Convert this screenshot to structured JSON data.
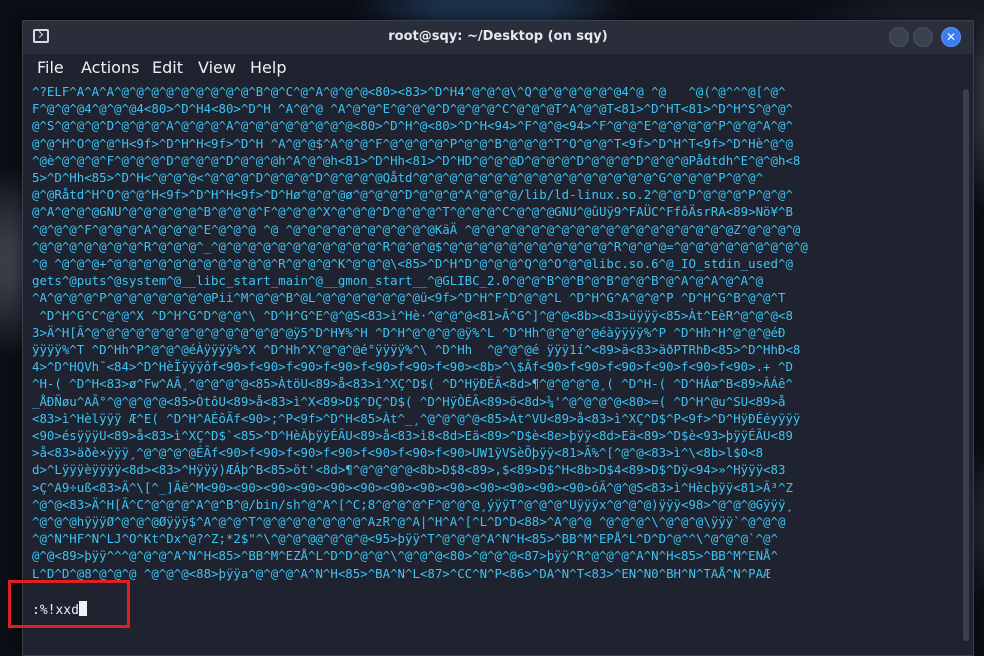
{
  "window": {
    "title": "root@sqy: ~/Desktop (on sqy)",
    "close_glyph": "✕"
  },
  "menu": [
    "File",
    "Actions",
    "Edit",
    "View",
    "Help"
  ],
  "terminal": {
    "lines": [
      "^?ELF^A^A^A^@^@^@^@^@^@^@^@^@^B^@^C^@^A^@^@^@<80><83>^D^H4^@^@^@\\^Q^@^@^@^@^@^@4^@ ^@   ^@(^@^^^@[^@^",
      "F^@^@^@4^@^@^@4<80>^D^H4<80>^D^H ^A^@^@ ^A^@^@^E^@^@^@^D^@^@^@^C^@^@^@T^A^@^@T<81>^D^HT<81>^D^H^S^@^@^",
      "@^S^@^@^@^D^@^@^@^A^@^@^@^A^@^@^@^@^@^@^@^@<80>^D^H^@<80>^D^H<94>^F^@^@<94>^F^@^@^E^@^@^@^@^P^@^@^A^@^",
      "@^@^H^O^@^@^H<9f>^D^H^H<9f>^D^H ^A^@^@$^A^@^@^F^@^@^@^@^P^@^@^B^@^@^@^T^O^@^@^T<9f>^D^H^T<9f>^D^Hè^@^@",
      "^@è^@^@^@^F^@^@^@^D^@^@^@^D^@^@^@h^A^@^@h<81>^D^Hh<81>^D^HD^@^@^@D^@^@^@^D^@^@^@^D^@^@^@Pådtdh^E^@^@h<8",
      "5>^D^Hh<85>^D^H<^@^@^@<^@^@^@^D^@^@^@^D^@^@^@^@Qåtd^@^@^@^@^@^@^@^@^@^@^@^@^@^@^@^@^G^@^@^@^P^@^@^",
      "@^@Råtd^H^O^@^@^H<9f>^D^H^H<9f>^D^Hø^@^@^@ø^@^@^@^D^@^@^@^A^@^@^@/lib/ld-linux.so.2^@^@^D^@^@^@^P^@^@^",
      "@^A^@^@^@GNU^@^@^@^@^@^B^@^@^@^F^@^@^@^X^@^@^@^D^@^@^@^T^@^@^@^C^@^@^@GNU^@ûUÿ9^FAÜC^FfôÄsrRA<89>Nö¥^B",
      "^@^@^@^F^@^@^@^A^@^@^@^E^@^@^@ ^@ ^@^@^@^@^@^@^@^@^@^@KäÄ ^@^@^@^@^@^@^@^@^@^@^@^@^@^@^@^@^@^@Z^@^@^@^@",
      "^@^@^@^@^@^@^@^R^@^@^@^_^@^@^@^@^@^@^@^@^@^@^@^R^@^@^@$^@^@^@^@^@^@^@^@^@^@^@^R^@^@^@=^@^@^@^@^@^@^@^@^@",
      "^@ ^@^@^@+^@^@^@^@^@^@^@^@^@^@^@^R^@^@^@^K^@^@^@\\<85>^D^H^D^@^@^@^Q^@^O^@^@libc.so.6^@_IO_stdin_used^@",
      "gets^@puts^@system^@__libc_start_main^@__gmon_start__^@GLIBC_2.0^@^@^B^@^B^@^B^@^@^B^@^A^@^A^@^A^@",
      "^A^@^@^@^P^@^@^@^@^@^@^@Pii^M^@^@^B^@L^@^@^@^@^@^@^@ü<9f>^D^H^F^D^@^@^L ^D^H^G^A^@^@^P ^D^H^G^B^@^@^T",
      " ^D^H^G^C^@^@^X ^D^H^G^D^@^@^\\ ^D^H^G^E^@^@S<83>ì^Hè·^@^@^@<81>Ã^G^]^@^@<8b><83>üÿÿÿ<85>Àt^EèR^@^@^@<8",
      "3>Ä^H[Ã^@^@^@^@^@^@^@^@^@^@^@^@^@^@ÿ5^D^H¥%^H ^D^H^@^@^@^@ÿ%^L ^D^Hh^@^@^@^@éàÿÿÿÿ%^P ^D^Hh^H^@^@^@éÐ",
      "ÿÿÿÿ%^T ^D^Hh^P^@^@^@éÀÿÿÿÿ%^X ^D^Hh^X^@^@^@é°ÿÿÿÿ%^\\ ^D^Hh  ^@^@^@é ÿÿÿ1í^<89>ä<83>äðPTRhÐ<85>^D^HhÐ<8",
      "4>^D^HQVh¯<84>^D^HèÏÿÿÿôf<90>f<90>f<90>f<90>f<90>f<90>f<90><8b>^\\$Ãf<90>f<90>f<90>f<90>f<90>f<90>.+ ^D",
      "^H-( ^D^H<83>ø^Fw^AÃ¸^@^@^@^@<85>ÀtöU<89>å<83>ì^XÇ^D$( ^D^HÿÐÉÃ<8d>¶^@^@^@^@¸( ^D^H-( ^D^HÁø^B<89>ÂÁê^",
      "_ÅÐÑøu^AÃ°^@^@^@^@<85>ÒtôU<89>å<83>ì^X<89>D$^DÇ^D$( ^D^HÿÒÉÃ<89>ö<8d>¼'^@^@^@^@<80>=( ^D^H^@u^SU<89>å",
      "<83>ì^Hèlÿÿÿ Æ^E( ^D^H^AÉôÃf<90>;^P<9f>^D^H<85>Àt^_¸^@^@^@^@<85>Àt^VU<89>å<83>ì^XÇ^D$^P<9f>^D^HÿÐÉéyÿÿÿ",
      "<90>ésÿÿÿU<89>å<83>ì^XÇ^D$`<85>^D^HèÀþÿÿÉÃU<89>å<83>ì8<8d>Eä<89>^D$è<8e>þÿÿ<8d>Eä<89>^D$è<93>þÿÿÉÃU<89",
      ">å<83>äðè×ÿÿÿ¸^@^@^@^@ÉÃf<90>f<90>f<90>f<90>f<90>f<90>f<90>UW1ÿVSèÕþÿÿ<81>Ã%^[^@^@<83>ì^\\<8b>l$0<8",
      "d>^Lÿÿÿèÿÿÿÿ<8d><83>^Hÿÿÿ)ÆÁþ^B<85>öt'<8d>¶^@^@^@^@<8b>D$8<89>,$<89>D$^H<8b>D$4<89>D$^Dÿ<94>»^Hÿÿÿ<83",
      ">Ç^A9÷uß<83>Ä^\\[^_]Ãë^M<90><90><90><90><90><90><90><90><90><90><90><90><90>óÃ^@^@S<83>ì^Hècþÿÿ<81>Ã³^Z",
      "^@^@<83>Ä^H[Ã^C^@^@^@^A^@^B^@/bin/sh^@^A^[^C;8^@^@^@^F^@^@^@¸ýÿÿT^@^@^@^Uÿÿÿx^@^@^@)ÿÿÿ<98>^@^@^@Gÿÿÿ¸",
      "^@^@^@hÿÿÿØ^@^@^@Øÿÿÿ$^A^@^@^T^@^@^@^@^@^@^@^AzR^@^A|^H^A^[^L^D^D<88>^A^@^@ ^@^@^@^\\^@^@^@\\ÿÿÿ`^@^@^@",
      "^@^N^HF^N^LJ^O^Kt^Dx^@?^Z;*2$\"^\\^@^@^@@^@^@^@<95>þÿÿ^T^@^@^@^A^N^H<85>^BB^M^EPÅ^L^D^D^@^^\\^@^@^@`^@^",
      "@^@<89>þÿÿ^^^@^@^@^A^N^H<85>^BB^M^EZÅ^L^D^D^@^@^\\^@^@^@<80>^@^@^@<87>þÿÿ^R^@^@^@^A^N^H<85>^BB^M^ENÅ^",
      "L^D^D^@8^@^@^@ ^@^@^@<88>þÿÿa^@^@^@^A^N^H<85>^BA^N^L<87>^CC^N^P<86>^DA^N^T<83>^EN^N0^BH^N^TAÅ^N^PAÆ"
    ],
    "prompt": ":%!xxd"
  },
  "colors": {
    "text": "#3ec3f2",
    "annotation": "#e02020"
  }
}
